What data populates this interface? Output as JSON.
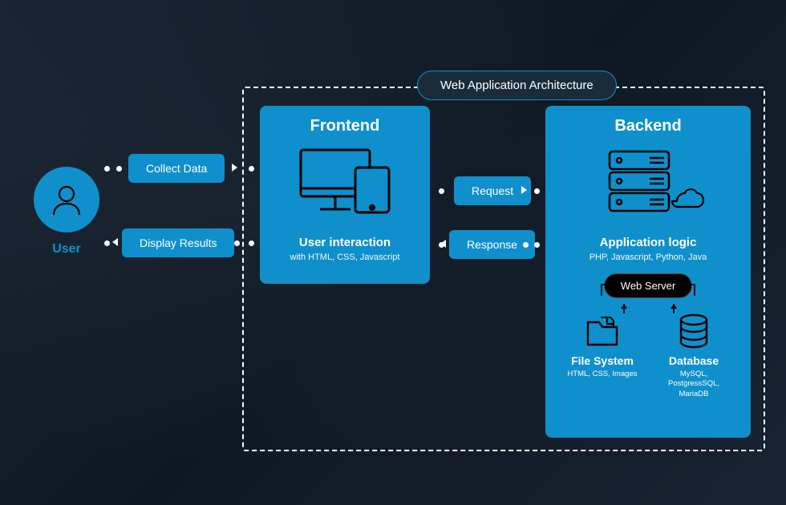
{
  "title": "Web Application Architecture",
  "user": {
    "label": "User"
  },
  "pills": {
    "collect": "Collect Data",
    "display": "Display Results",
    "request": "Request",
    "response": "Response"
  },
  "frontend": {
    "title": "Frontend",
    "sub1": "User interaction",
    "sub2": "with HTML, CSS, Javascript"
  },
  "backend": {
    "title": "Backend",
    "sub1": "Application logic",
    "sub2": "PHP, Javascript, Python, Java",
    "webserver": "Web Server",
    "filesystem": {
      "title": "File System",
      "sub": "HTML, CSS, Images"
    },
    "database": {
      "title": "Database",
      "sub": "MySQL, PostgressSQL, MariaDB"
    }
  },
  "colors": {
    "accent": "#0f90cc",
    "bg": "#14202d"
  }
}
